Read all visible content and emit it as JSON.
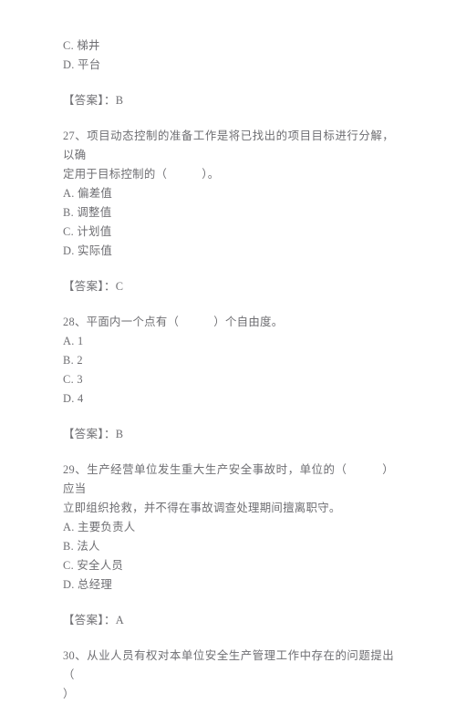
{
  "document": {
    "type": "exam-question-sheet",
    "language": "zh-CN",
    "text_color": "#6e6e72",
    "background_color": "#ffffff",
    "answer_label": "【答案】：",
    "blocks": [
      {
        "kind": "orphan-options",
        "options": [
          "C. 梯井",
          "D. 平台"
        ]
      },
      {
        "kind": "answer",
        "text": "【答案】：B"
      },
      {
        "kind": "question",
        "number": "27",
        "stem_lines": [
          "27、项目动态控制的准备工作是将已找出的项目目标进行分解，以确",
          "定用于目标控制的（　　　）。"
        ],
        "options": [
          "A. 偏差值",
          "B. 调整值",
          "C. 计划值",
          "D. 实际值"
        ]
      },
      {
        "kind": "answer",
        "text": "【答案】：C"
      },
      {
        "kind": "question",
        "number": "28",
        "stem_lines": [
          "28、平面内一个点有（　　　）个自由度。"
        ],
        "options": [
          "A. 1",
          "B. 2",
          "C. 3",
          "D. 4"
        ]
      },
      {
        "kind": "answer",
        "text": "【答案】：B"
      },
      {
        "kind": "question",
        "number": "29",
        "stem_lines": [
          "29、生产经营单位发生重大生产安全事故时，单位的（　　　）应当",
          "立即组织抢救，并不得在事故调查处理期间擅离职守。"
        ],
        "options": [
          "A. 主要负责人",
          "B. 法人",
          "C. 安全人员",
          "D. 总经理"
        ]
      },
      {
        "kind": "answer",
        "text": "【答案】：A"
      },
      {
        "kind": "question",
        "number": "30",
        "stem_lines": [
          "30、从业人员有权对本单位安全生产管理工作中存在的问题提出（",
          "）"
        ],
        "options": []
      }
    ]
  }
}
